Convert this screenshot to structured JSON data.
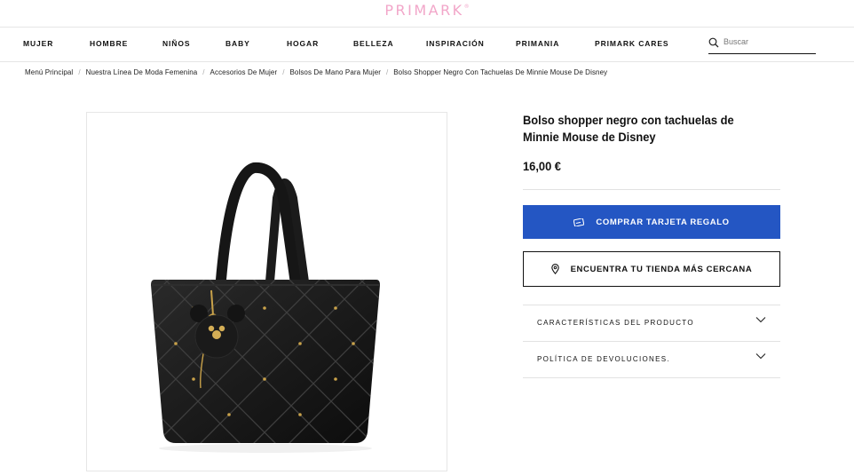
{
  "header": {
    "logo": "PRIMARK",
    "logo_mark": "®"
  },
  "nav": {
    "items": [
      {
        "label": "MUJER"
      },
      {
        "label": "HOMBRE"
      },
      {
        "label": "NIÑOS"
      },
      {
        "label": "BABY"
      },
      {
        "label": "HOGAR"
      },
      {
        "label": "BELLEZA"
      },
      {
        "label": "INSPIRACIÓN"
      },
      {
        "label": "PRIMANIA"
      },
      {
        "label": "PRIMARK CARES"
      }
    ],
    "search_placeholder": "Buscar"
  },
  "breadcrumb": [
    "Menú Principal",
    "Nuestra Línea De Moda Femenina",
    "Accesorios De Mujer",
    "Bolsos De Mano Para Mujer",
    "Bolso Shopper Negro Con Tachuelas De Minnie Mouse De Disney"
  ],
  "product": {
    "title": "Bolso shopper negro con tachuelas de Minnie Mouse de Disney",
    "price": "16,00 €",
    "gift_card_button": "COMPRAR TARJETA REGALO",
    "store_button": "ENCUENTRA TU TIENDA MÁS CERCANA",
    "accordions": [
      {
        "label": "CARACTERÍSTICAS DEL PRODUCTO"
      },
      {
        "label": "POLÍTICA DE DEVOLUCIONES."
      }
    ]
  },
  "colors": {
    "brand_pink": "#f2a6c9",
    "button_blue": "#2456c3"
  },
  "icons": [
    "search-icon",
    "gift-card-icon",
    "location-pin-icon",
    "chevron-down-icon"
  ]
}
